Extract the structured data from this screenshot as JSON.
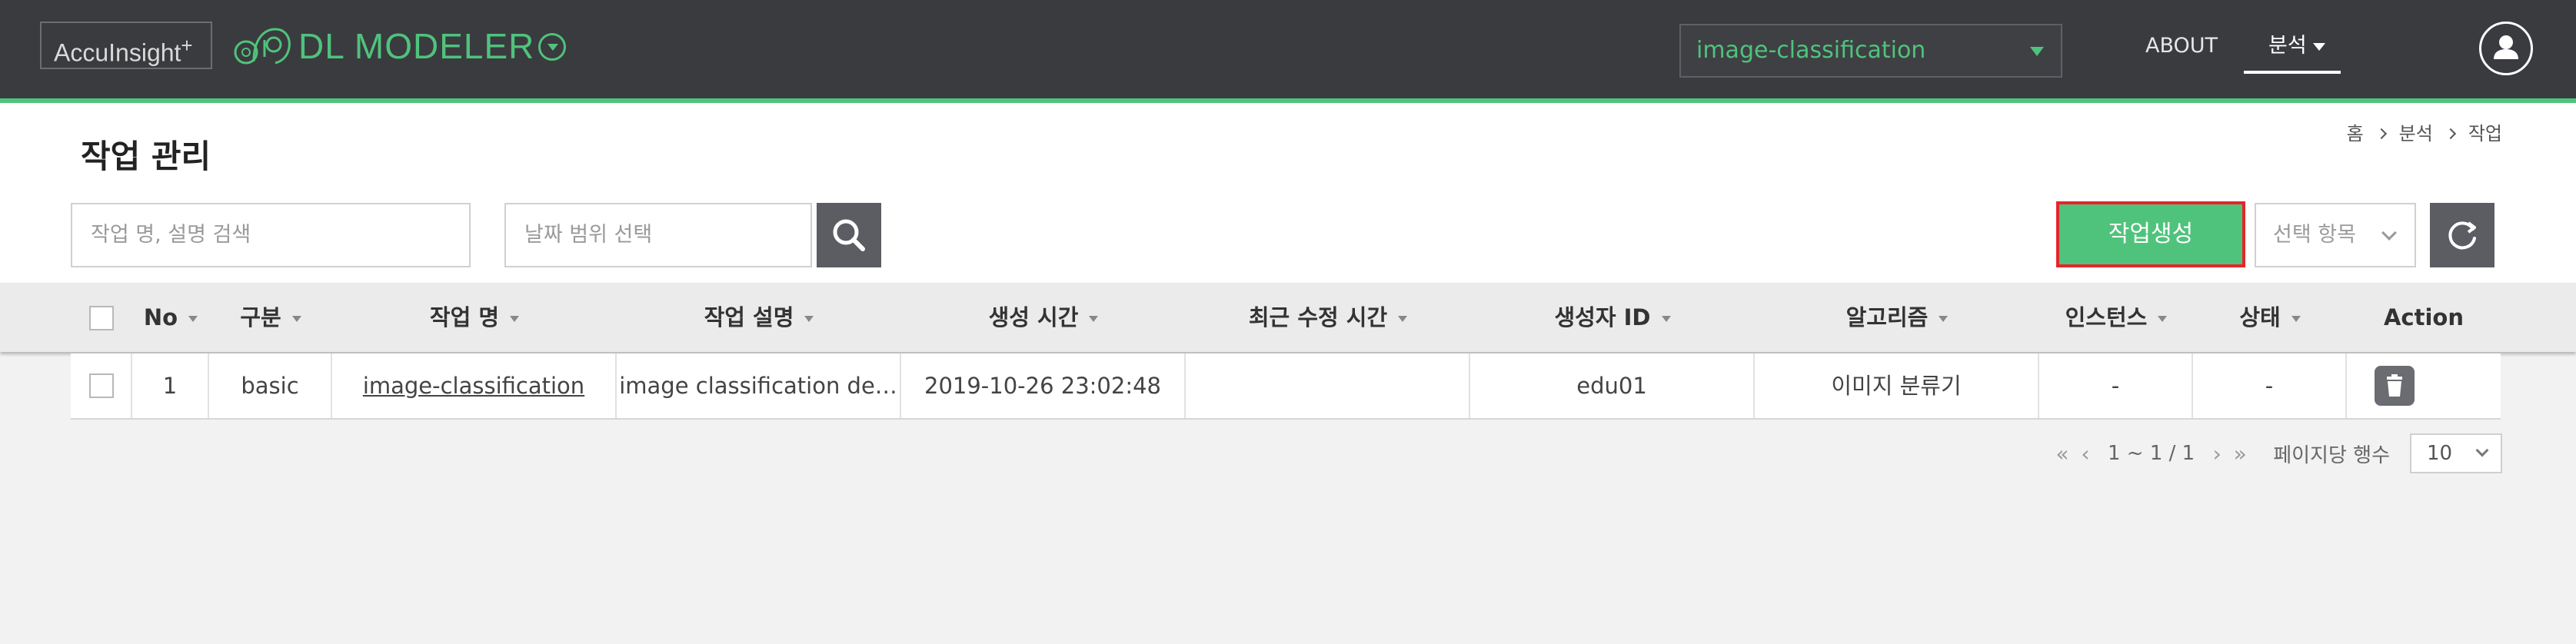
{
  "header": {
    "brand": "AccuInsight",
    "brand_sup": "+",
    "app_title": "DL MODELER",
    "project_select_value": "image-classification",
    "nav_about": "ABOUT",
    "nav_analysis": "분석"
  },
  "page": {
    "title": "작업 관리",
    "breadcrumb": [
      "홈",
      "분석",
      "작업"
    ]
  },
  "toolbar": {
    "search_placeholder": "작업 명, 설명 검색",
    "date_placeholder": "날짜 범위 선택",
    "create_label": "작업생성",
    "column_select_placeholder": "선택 항목"
  },
  "table": {
    "headers": {
      "no": "No",
      "type": "구분",
      "name": "작업 명",
      "description": "작업 설명",
      "created": "생성 시간",
      "modified": "최근 수정 시간",
      "creator": "생성자 ID",
      "algorithm": "알고리즘",
      "instance": "인스턴스",
      "status": "상태",
      "action": "Action"
    },
    "rows": [
      {
        "no": "1",
        "type": "basic",
        "name": "image-classification",
        "description": "image classification de…",
        "created": "2019-10-26 23:02:48",
        "modified": "",
        "creator": "edu01",
        "algorithm": "이미지 분류기",
        "instance": "-",
        "status": "-"
      }
    ]
  },
  "pagination": {
    "range": "1 ~ 1 / 1",
    "per_page_label": "페이지당 행수",
    "per_page_value": "10"
  },
  "colors": {
    "header_bg": "#3a3b3f",
    "accent": "#4fc37c",
    "highlight_border": "#e5252a",
    "button_dark": "#5b5d63"
  },
  "icons": [
    "dl-modeler-logo-icon",
    "chevron-down-circle-icon",
    "caret-down-icon",
    "user-icon",
    "search-icon",
    "refresh-icon",
    "sort-caret-icon",
    "trash-icon",
    "first-page-icon",
    "prev-page-icon",
    "next-page-icon",
    "last-page-icon"
  ]
}
